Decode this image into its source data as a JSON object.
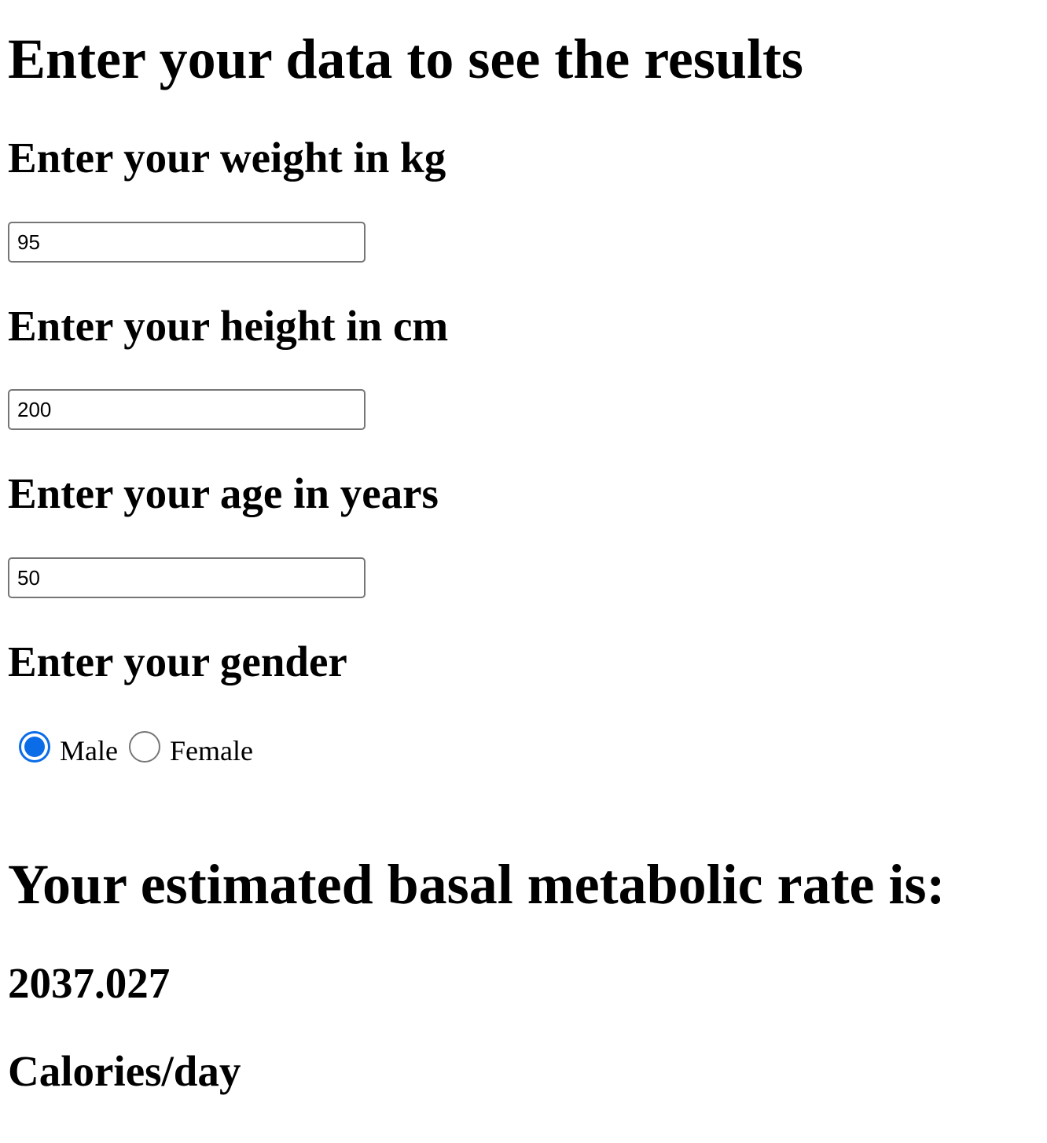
{
  "page": {
    "title": "Enter your data to see the results"
  },
  "form": {
    "weight": {
      "label": "Enter your weight in kg",
      "value": "95"
    },
    "height": {
      "label": "Enter your height in cm",
      "value": "200"
    },
    "age": {
      "label": "Enter your age in years",
      "value": "50"
    },
    "gender": {
      "label": "Enter your gender",
      "options": [
        {
          "label": "Male",
          "selected": true
        },
        {
          "label": "Female",
          "selected": false
        }
      ]
    }
  },
  "result": {
    "heading": "Your estimated basal metabolic rate is:",
    "value": "2037.027",
    "unit": "Calories/day"
  },
  "colors": {
    "accent": "#0b6ce8",
    "input_border": "#767676"
  }
}
